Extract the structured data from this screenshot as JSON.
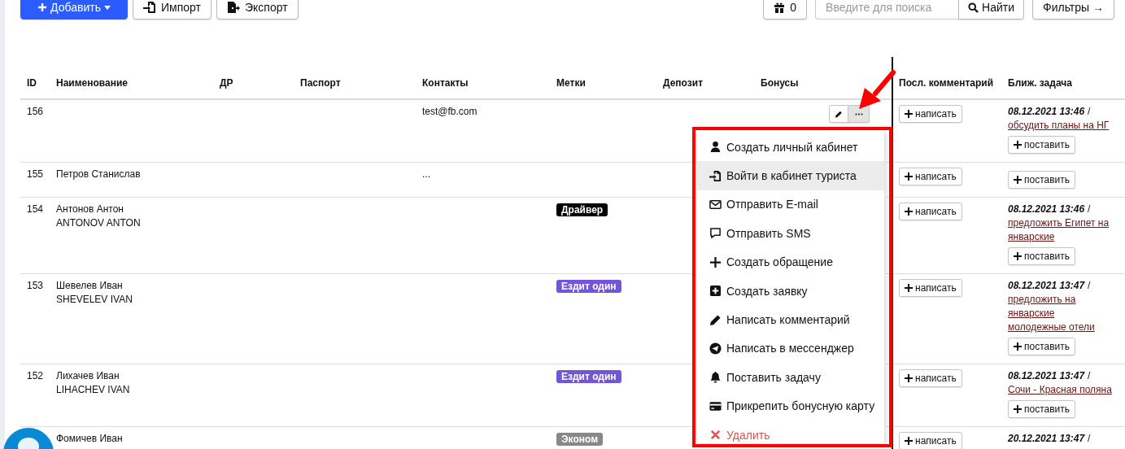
{
  "toolbar": {
    "add_button": "Добавить",
    "import_button": "Импорт",
    "export_button": "Экспорт",
    "gift_button": "0",
    "search": {
      "placeholder": "Введите для поиска"
    },
    "search_button": "Найти",
    "filters_button": "Фильтры →"
  },
  "table": {
    "columns": [
      "ID",
      "Наименование",
      "ДР",
      "Паспорт",
      "Контакты",
      "Метки",
      "Депозит",
      "Бонусы",
      "Посл. комментарий",
      "Ближ. задача"
    ],
    "rows": [
      {
        "id": "156",
        "contacts": "test@fb.com",
        "actions": {
          "more_selected": true
        },
        "comment_button": "написать",
        "task": {
          "date": "08.12.2021 13:46",
          "separator": "/",
          "link": "обсудить планы на НГ",
          "button": "поставить"
        }
      },
      {
        "id": "155",
        "name_lines": [
          "Петров Станислав"
        ],
        "contacts": "...",
        "comment_button": "написать",
        "task": {
          "button": "поставить"
        }
      },
      {
        "id": "154",
        "name_lines": [
          "Антонов Антон",
          "ANTONOV ANTON"
        ],
        "tag": {
          "text": "Драйвер",
          "color": "#000000"
        },
        "comment_button": "написать",
        "task": {
          "date": "08.12.2021 13:46",
          "separator": "/",
          "link": "предложить Египет на\nянварские",
          "button": "поставить"
        }
      },
      {
        "id": "153",
        "name_lines": [
          "Шевелев Иван",
          "SHEVELEV IVAN"
        ],
        "tag": {
          "text": "Ездит один",
          "color": "#7355d8"
        },
        "comment_button": "написать",
        "task": {
          "date": "08.12.2021 13:47",
          "separator": "/",
          "link": "предложить на\nянварские\nмолодежные отели",
          "button": "поставить"
        }
      },
      {
        "id": "152",
        "name_lines": [
          "Лихачев Иван",
          "LIHACHEV IVAN"
        ],
        "tag": {
          "text": "Ездит один",
          "color": "#7355d8"
        },
        "comment_button": "написать",
        "task": {
          "date": "08.12.2021 13:47",
          "separator": "/",
          "link": "Сочи - Красная поляна",
          "button": "поставить"
        }
      },
      {
        "id": "",
        "name_lines": [
          "Фомичев Иван"
        ],
        "tag": {
          "text": "Эконом",
          "color": "#888888"
        },
        "comment_button": "написать",
        "task": {
          "date": "20.12.2021 13:47",
          "separator": "/"
        }
      }
    ]
  },
  "dropdown": {
    "items": [
      {
        "kind": "user",
        "label": "Создать личный кабинет",
        "selected": false
      },
      {
        "kind": "login",
        "label": "Войти в кабинет туриста",
        "selected": true
      },
      {
        "kind": "mail",
        "label": "Отправить E-mail",
        "selected": false
      },
      {
        "kind": "sms",
        "label": "Отправить SMS",
        "selected": false
      },
      {
        "kind": "plus",
        "label": "Создать обращение",
        "selected": false
      },
      {
        "kind": "plus-square",
        "label": "Создать заявку",
        "selected": false
      },
      {
        "kind": "pencil",
        "label": "Написать комментарий",
        "selected": false
      },
      {
        "kind": "send",
        "label": "Написать в мессенджер",
        "selected": false
      },
      {
        "kind": "bell",
        "label": "Поставить задачу",
        "selected": false
      },
      {
        "kind": "card",
        "label": "Прикрепить бонусную карту",
        "selected": false
      },
      {
        "kind": "delete",
        "label": "Удалить",
        "selected": false
      }
    ]
  }
}
